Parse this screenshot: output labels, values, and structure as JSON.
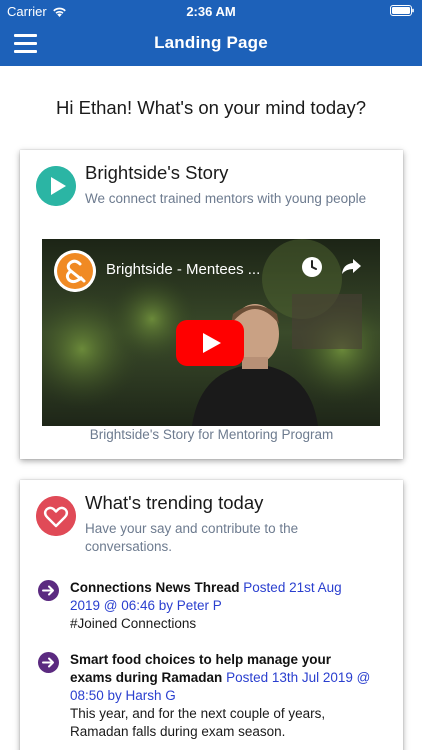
{
  "status_bar": {
    "carrier": "Carrier",
    "time": "2:36 AM"
  },
  "nav": {
    "title": "Landing Page",
    "menu_icon": "hamburger-menu-icon"
  },
  "greeting": "Hi Ethan! What's on your mind today?",
  "story_card": {
    "icon": "play-icon",
    "title": "Brightside's Story",
    "subtitle": "We connect trained mentors with young people",
    "video": {
      "title": "Brightside - Mentees ...",
      "channel_icon": "brightside-logo-icon"
    },
    "caption": "Brightside's Story for Mentoring Program"
  },
  "trending_card": {
    "icon": "heart-icon",
    "title": "What's trending today",
    "subtitle": "Have your say and contribute to the conversations.",
    "items": [
      {
        "title": "Connections News Thread",
        "meta": "Posted 21st Aug 2019 @ 06:46 by Peter P",
        "body": "#Joined Connections"
      },
      {
        "title": "Smart food choices to help manage your exams during Ramadan",
        "meta": "Posted 13th Jul 2019 @ 08:50 by Harsh G",
        "body": "This year, and for the next couple of years, Ramadan falls during exam season."
      }
    ]
  },
  "colors": {
    "header_blue": "#1d61b9",
    "play_teal": "#2bb5a4",
    "heart_red": "#e04a57",
    "arrow_purple": "#5b2a80",
    "meta_blue": "#2a3fcf",
    "subtitle_gray": "#6d7b8f",
    "youtube_red": "#ff0000",
    "brand_orange": "#f08a24"
  }
}
